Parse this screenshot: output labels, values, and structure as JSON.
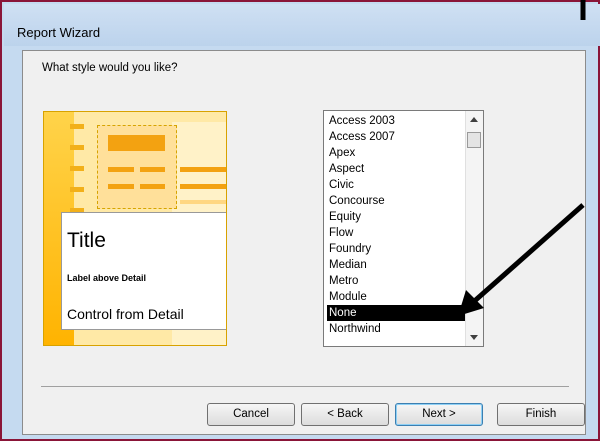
{
  "window": {
    "title": "Report Wizard"
  },
  "wizard": {
    "question": "What style would you like?",
    "preview": {
      "title": "Title",
      "label": "Label above Detail",
      "control": "Control from Detail"
    },
    "styles": [
      "Access 2003",
      "Access 2007",
      "Apex",
      "Aspect",
      "Civic",
      "Concourse",
      "Equity",
      "Flow",
      "Foundry",
      "Median",
      "Metro",
      "Module",
      "None",
      "Northwind"
    ],
    "selected_style": "None"
  },
  "buttons": {
    "cancel": "Cancel",
    "back": "< Back",
    "next": "Next >",
    "finish": "Finish"
  },
  "colors": {
    "frame": "#8a1538",
    "accent": "#f3a211",
    "selection": "#000000"
  }
}
